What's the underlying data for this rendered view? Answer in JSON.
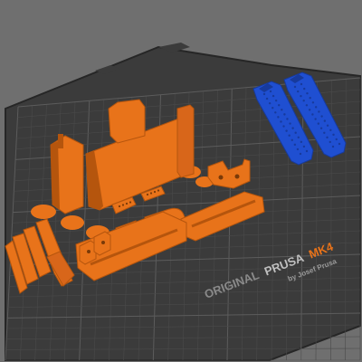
{
  "viewport": {
    "bed_brand_prefix": "ORIGINAL",
    "bed_brand_name": "PRUSA",
    "bed_model": "MK4",
    "bed_byline": "by Josef Prusa"
  },
  "colors": {
    "background": "#6f6f6f",
    "bed_surface": "#3b3b3b",
    "bed_edge": "#262626",
    "grid_minor": "#4a4a4a",
    "grid_major": "#5c5c5c",
    "part_on_bed": "#e8731a",
    "part_on_bed_dark": "#b5550d",
    "part_off_bed": "#1f4fd1",
    "part_off_bed_dark": "#173a9c",
    "logo_text": "#8a8a8a",
    "logo_accent": "#e8731a"
  },
  "objects": {
    "on_bed_count_label": "",
    "off_bed_count_label": ""
  }
}
